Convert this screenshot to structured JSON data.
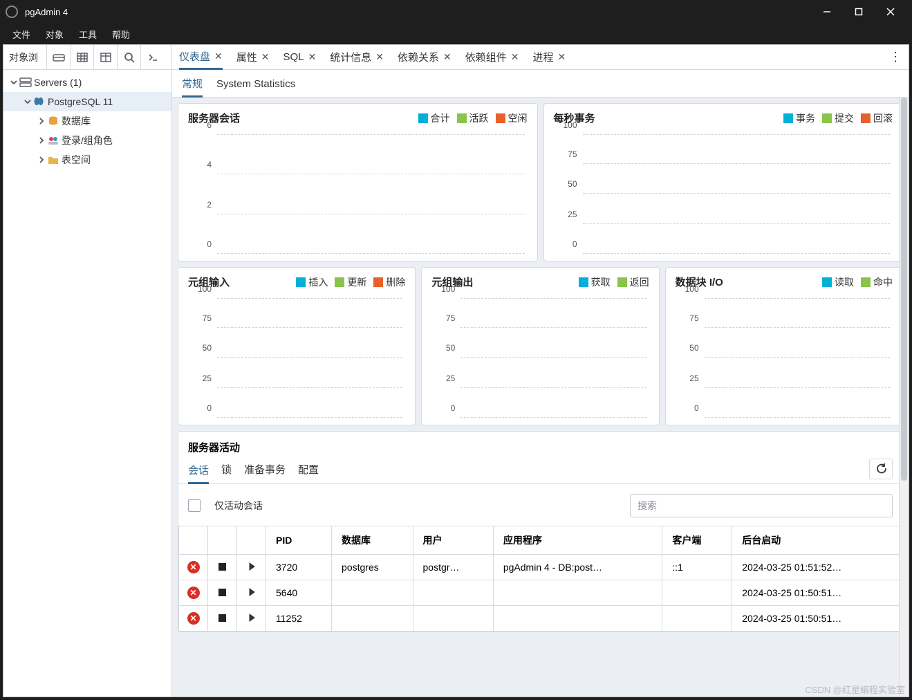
{
  "window": {
    "title": "pgAdmin 4"
  },
  "menubar": [
    "文件",
    "对象",
    "工具",
    "帮助"
  ],
  "sidebar": {
    "header_label": "对象浏",
    "tree": {
      "servers": {
        "label": "Servers (1)"
      },
      "server1": {
        "label": "PostgreSQL 11"
      },
      "db": {
        "label": "数据库"
      },
      "roles": {
        "label": "登录/组角色"
      },
      "tablespace": {
        "label": "表空间"
      }
    }
  },
  "tabs": {
    "items": [
      {
        "label": "仪表盘",
        "active": true
      },
      {
        "label": "属性"
      },
      {
        "label": "SQL"
      },
      {
        "label": "统计信息"
      },
      {
        "label": "依赖关系"
      },
      {
        "label": "依赖组件"
      },
      {
        "label": "进程"
      }
    ]
  },
  "subtabs": {
    "general": "常规",
    "sysstats": "System Statistics"
  },
  "charts": {
    "sessions": {
      "title": "服务器会话",
      "legend": [
        "合计",
        "活跃",
        "空闲"
      ]
    },
    "tps": {
      "title": "每秒事务",
      "legend": [
        "事务",
        "提交",
        "回滚"
      ]
    },
    "tin": {
      "title": "元组输入",
      "legend": [
        "插入",
        "更新",
        "删除"
      ]
    },
    "tout": {
      "title": "元组输出",
      "legend": [
        "获取",
        "返回"
      ]
    },
    "bio": {
      "title": "数据块 I/O",
      "legend": [
        "读取",
        "命中"
      ]
    }
  },
  "legend_colors": {
    "c1": "#00b0d8",
    "c2": "#8ac44b",
    "c3": "#e8602c"
  },
  "chart_data": [
    {
      "type": "line",
      "title": "服务器会话",
      "series": [
        {
          "name": "合计",
          "values": []
        },
        {
          "name": "活跃",
          "values": []
        },
        {
          "name": "空闲",
          "values": []
        }
      ],
      "ylim": [
        0,
        6
      ],
      "yticks": [
        0,
        2,
        4,
        6
      ]
    },
    {
      "type": "line",
      "title": "每秒事务",
      "series": [
        {
          "name": "事务",
          "values": []
        },
        {
          "name": "提交",
          "values": []
        },
        {
          "name": "回滚",
          "values": []
        }
      ],
      "ylim": [
        0,
        100
      ],
      "yticks": [
        0,
        25,
        50,
        75,
        100
      ]
    },
    {
      "type": "line",
      "title": "元组输入",
      "series": [
        {
          "name": "插入",
          "values": []
        },
        {
          "name": "更新",
          "values": []
        },
        {
          "name": "删除",
          "values": []
        }
      ],
      "ylim": [
        0,
        100
      ],
      "yticks": [
        0,
        25,
        50,
        75,
        100
      ]
    },
    {
      "type": "line",
      "title": "元组输出",
      "series": [
        {
          "name": "获取",
          "values": []
        },
        {
          "name": "返回",
          "values": []
        }
      ],
      "ylim": [
        0,
        100
      ],
      "yticks": [
        0,
        25,
        50,
        75,
        100
      ]
    },
    {
      "type": "line",
      "title": "数据块 I/O",
      "series": [
        {
          "name": "读取",
          "values": []
        },
        {
          "name": "命中",
          "values": []
        }
      ],
      "ylim": [
        0,
        100
      ],
      "yticks": [
        0,
        25,
        50,
        75,
        100
      ]
    }
  ],
  "activity": {
    "title": "服务器活动",
    "tabs": [
      "会话",
      "锁",
      "准备事务",
      "配置"
    ],
    "active_only_label": "仅活动会话",
    "search_placeholder": "搜索",
    "columns": [
      "",
      "",
      "",
      "PID",
      "数据库",
      "用户",
      "应用程序",
      "客户端",
      "后台启动"
    ],
    "rows": [
      {
        "pid": "3720",
        "db": "postgres",
        "user": "postgr…",
        "app": "pgAdmin 4 - DB:post…",
        "client": "::1",
        "start": "2024-03-25 01:51:52…"
      },
      {
        "pid": "5640",
        "db": "",
        "user": "",
        "app": "",
        "client": "",
        "start": "2024-03-25 01:50:51…"
      },
      {
        "pid": "11252",
        "db": "",
        "user": "",
        "app": "",
        "client": "",
        "start": "2024-03-25 01:50:51…"
      }
    ]
  },
  "watermark": "CSDN @红星编程实验室"
}
